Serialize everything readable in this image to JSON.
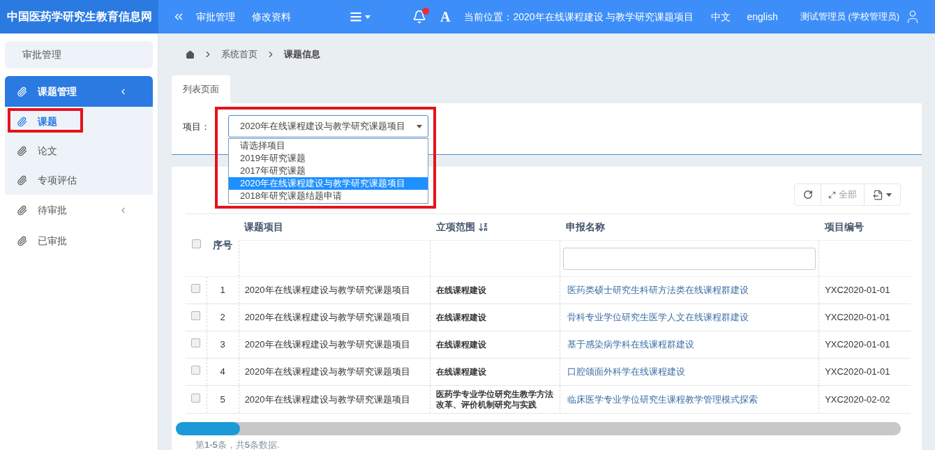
{
  "header": {
    "logo": "中国医药学研究生教育信息网",
    "nav": [
      "审批管理",
      "修改资料"
    ],
    "notification_dot": true,
    "font_button": "A",
    "location": "当前位置：2020年在线课程建设 与教学研究课题项目",
    "languages": [
      "中文",
      "english"
    ],
    "user": "测试管理员 (学校管理员)"
  },
  "sidebar": {
    "top_item": "审批管理",
    "items": [
      {
        "label": "课题管理",
        "kind": "group",
        "expanded": true,
        "selected": true,
        "children": [
          {
            "label": "课题",
            "selected": true
          },
          {
            "label": "论文",
            "selected": false
          },
          {
            "label": "专项评估",
            "selected": false
          }
        ]
      },
      {
        "label": "待审批",
        "kind": "group",
        "expanded": false,
        "selected": false
      },
      {
        "label": "已审批",
        "kind": "link",
        "selected": false
      }
    ]
  },
  "breadcrumb": [
    "系统首页",
    "课题信息"
  ],
  "tabs": [
    {
      "label": "列表页面",
      "selected": true
    }
  ],
  "filter": {
    "label": "项目：",
    "value": "2020年在线课程建设与教学研究课题项目",
    "expanded": true,
    "options": [
      {
        "label": "请选择项目",
        "selected": false
      },
      {
        "label": "2019年研究课题",
        "selected": false
      },
      {
        "label": "2017年研究课题",
        "selected": false
      },
      {
        "label": "2020年在线课程建设与教学研究课题项目",
        "selected": true
      },
      {
        "label": "2018年研究课题结题申请",
        "selected": false
      }
    ]
  },
  "toolbar": {
    "expand_label": "全部"
  },
  "table": {
    "select_all_checked": false,
    "columns": [
      {
        "label": "序号"
      },
      {
        "label": "课题项目"
      },
      {
        "label": "立项范围",
        "sortable": true
      },
      {
        "label": "申报名称",
        "filter": true
      },
      {
        "label": "项目编号"
      }
    ],
    "rows": [
      {
        "checked": false,
        "cells": [
          "1",
          "2020年在线课程建设与教学研究课题项目",
          "在线课程建设",
          "医药类硕士研究生科研方法类在线课程群建设",
          "YXC2020-01-01"
        ]
      },
      {
        "checked": false,
        "cells": [
          "2",
          "2020年在线课程建设与教学研究课题项目",
          "在线课程建设",
          "骨科专业学位研究生医学人文在线课程群建设",
          "YXC2020-01-01"
        ]
      },
      {
        "checked": false,
        "cells": [
          "3",
          "2020年在线课程建设与教学研究课题项目",
          "在线课程建设",
          "基于感染病学科在线课程群建设",
          "YXC2020-01-01"
        ]
      },
      {
        "checked": false,
        "cells": [
          "4",
          "2020年在线课程建设与教学研究课题项目",
          "在线课程建设",
          "口腔颌面外科学在线课程建设",
          "YXC2020-01-01"
        ]
      },
      {
        "checked": false,
        "cells": [
          "5",
          "2020年在线课程建设与教学研究课题项目",
          "医药学专业学位研究生教学方法改革、评价机制研究与实践",
          "临床医学专业学位研究生课程教学管理模式探索",
          "YXC2020-02-02"
        ]
      }
    ]
  },
  "footer": "第**1-5**条，共**5**条数据."
}
